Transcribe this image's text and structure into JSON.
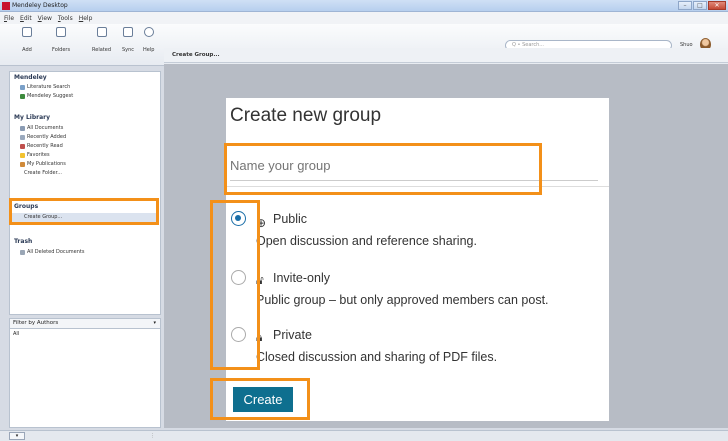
{
  "window": {
    "title": "Mendeley Desktop",
    "controls": [
      "–",
      "□",
      "✕"
    ]
  },
  "menu": [
    "File",
    "Edit",
    "View",
    "Tools",
    "Help"
  ],
  "toolbar": {
    "buttons": [
      {
        "label": "Add",
        "icon": "add-document-icon"
      },
      {
        "label": "Folders",
        "icon": "folder-icon"
      },
      {
        "label": "Related",
        "icon": "related-icon"
      },
      {
        "label": "Sync",
        "icon": "sync-icon"
      },
      {
        "label": "Help",
        "icon": "help-icon"
      }
    ],
    "search_placeholder": "Q • Search...",
    "user_name": "Shuo"
  },
  "sidebar": {
    "sections": [
      {
        "heading": "Mendeley",
        "items": [
          "Literature Search",
          "Mendeley Suggest"
        ]
      },
      {
        "heading": "My Library",
        "items": [
          "All Documents",
          "Recently Added",
          "Recently Read",
          "Favorites",
          "My Publications",
          "Create Folder..."
        ]
      },
      {
        "heading": "Groups",
        "items": [
          "Create Group..."
        ]
      },
      {
        "heading": "Trash",
        "items": [
          "All Deleted Documents"
        ]
      }
    ],
    "filter": {
      "label": "Filter by Authors",
      "arrow": "▾",
      "value": "All"
    }
  },
  "main": {
    "breadcrumb": "Create Group..."
  },
  "dialog": {
    "title": "Create new group",
    "name_placeholder": "Name your group",
    "options": [
      {
        "label": "Public",
        "icon": "globe-icon",
        "description": "Open discussion and reference sharing.",
        "checked": true
      },
      {
        "label": "Invite-only",
        "icon": "unlock-icon",
        "description": "Public group – but only approved members can post.",
        "checked": false
      },
      {
        "label": "Private",
        "icon": "lock-icon",
        "description": "Closed discussion and sharing of PDF files.",
        "checked": false
      }
    ],
    "create_label": "Create"
  },
  "colors": {
    "highlight": "#f39019",
    "create_button": "#0e6f8f",
    "radio_checked": "#1a6ea8"
  }
}
